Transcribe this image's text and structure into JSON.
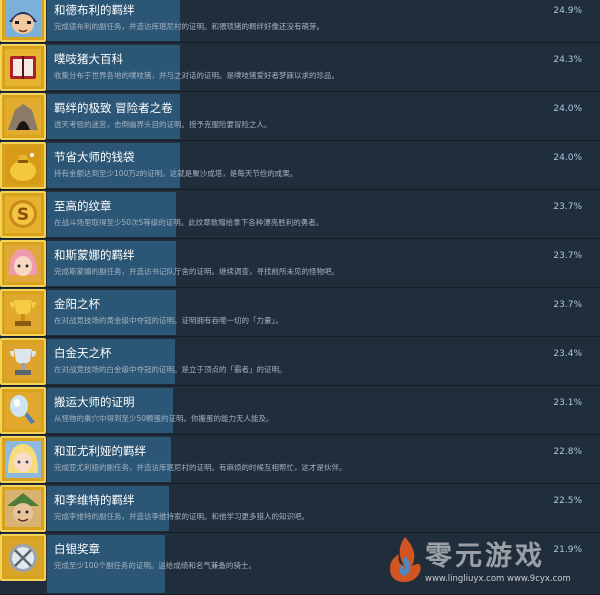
{
  "achievements": [
    {
      "title": "和德布利的羁绊",
      "description": "完成德布利的副任务，并造访库珉尼村的证明。和猥琐猪的羁绊好像还没有萌芽。",
      "percent": "24.9%",
      "icon": "chibi-hero-portrait-icon",
      "progress": 0.3
    },
    {
      "title": "噗吱猪大百科",
      "description": "收集分布于世界各地的噗吱猪，并与之对话的证明。是噗吱猪爱好者梦寐以求的珍品。",
      "percent": "24.3%",
      "icon": "red-book-icon",
      "progress": 0.3
    },
    {
      "title": "羁绊的极致 冒险者之卷",
      "description": "透天考验的迷宫，击倒幽界头目的证明。授予克服险要冒险之人。",
      "percent": "24.0%",
      "icon": "cave-dungeon-icon",
      "progress": 0.3
    },
    {
      "title": "节省大师的钱袋",
      "description": "持有金额达到至少100万z的证明。这就是聚沙成塔，是每天节俭的成果。",
      "percent": "24.0%",
      "icon": "gold-money-bag-icon",
      "progress": 0.3
    },
    {
      "title": "至高的纹章",
      "description": "在战斗场里取得至少50次S等级的证明。此纹章致赠给拿下各种漂亮胜利的勇者。",
      "percent": "23.7%",
      "icon": "gold-s-medal-icon",
      "progress": 0.29
    },
    {
      "title": "和斯蒙娜的羁绊",
      "description": "完成斯蒙娜的副任务，并造访书记队厅舍的证明。继续调查，寻找前所未见的怪物吧。",
      "percent": "23.7%",
      "icon": "pink-hair-girl-portrait-icon",
      "progress": 0.29
    },
    {
      "title": "金阳之杯",
      "description": "在对战竞技场的黄金级中夺冠的证明。证明拥有吞噬一切的「力量」。",
      "percent": "23.7%",
      "icon": "gold-trophy-icon",
      "progress": 0.29
    },
    {
      "title": "白金天之杯",
      "description": "在对战竞技场的白金级中夺冠的证明。是立于顶点的「霸者」的证明。",
      "percent": "23.4%",
      "icon": "platinum-trophy-icon",
      "progress": 0.29
    },
    {
      "title": "搬运大师的证明",
      "description": "从怪物的巢穴中得到至少50颗蛋的证明。你搬蛋的能力无人能及。",
      "percent": "23.1%",
      "icon": "egg-carrier-icon",
      "progress": 0.28
    },
    {
      "title": "和亚尤利娅的羁绊",
      "description": "完成亚尤利娅的副任务，并造访库珉尼村的证明。有麻烦的时候互相帮忙，这才是伙伴。",
      "percent": "22.8%",
      "icon": "blonde-girl-portrait-icon",
      "progress": 0.28
    },
    {
      "title": "和李维特的羁绊",
      "description": "完成李维特的副任务，并造访李维特家的证明。和他学习更多猎人的知识吧。",
      "percent": "22.5%",
      "icon": "green-hat-hunter-portrait-icon",
      "progress": 0.27
    },
    {
      "title": "白银奖章",
      "description": "完成至少100个副任务的证明。送给成绩和名气兼备的骑士。",
      "percent": "21.9%",
      "icon": "silver-medal-icon",
      "progress": 0.27
    }
  ],
  "watermark": {
    "brand_text": "零元游戏",
    "urls": "www.lingliuyx.com  www.9cyx.com"
  },
  "colors": {
    "background": "#1b2838",
    "row": "#202d3b",
    "bar": "#2c5675",
    "icon_gold": "#d9a21b",
    "title": "#ffffff",
    "description": "#a4b3c1",
    "percent": "#a8c8e0"
  }
}
